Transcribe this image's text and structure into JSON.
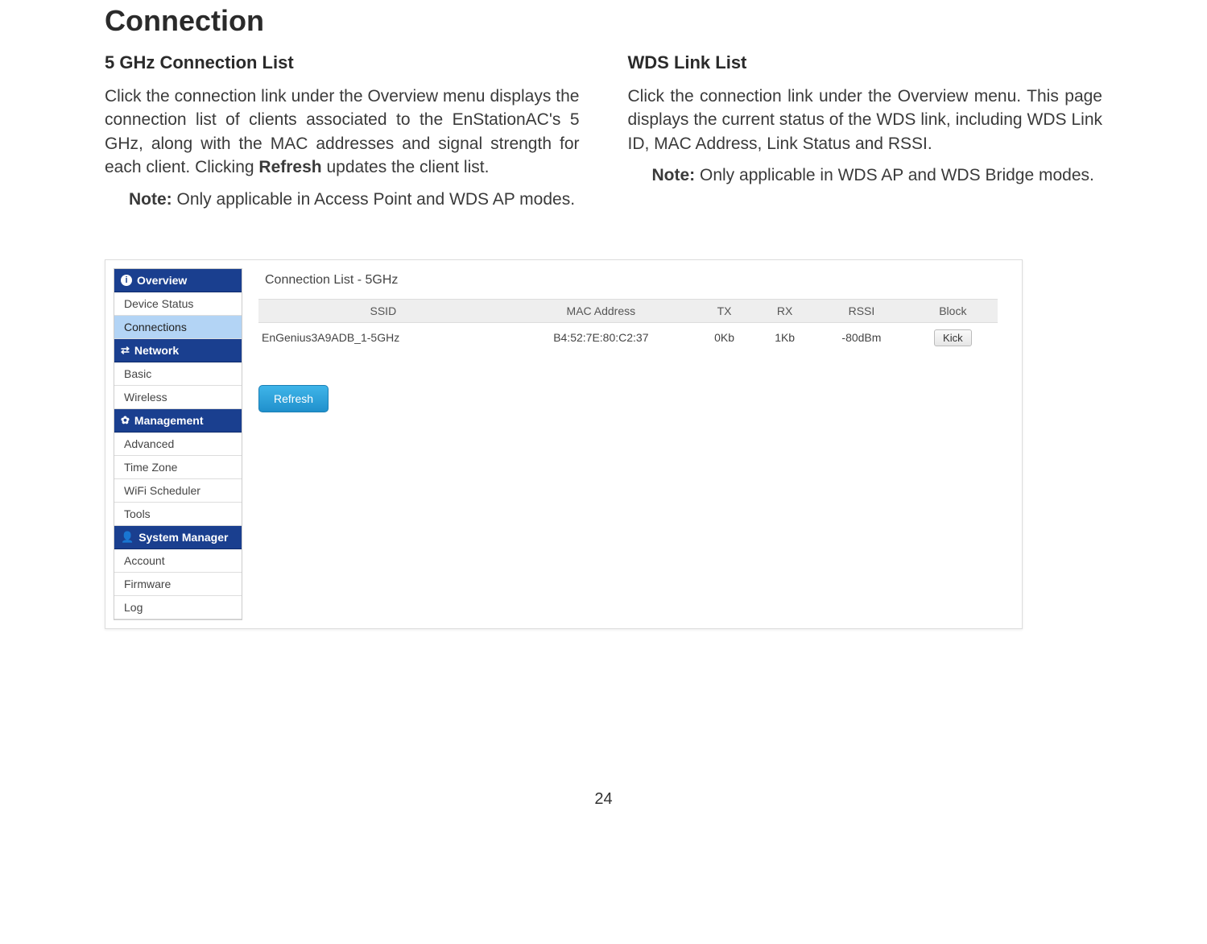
{
  "page": {
    "title": "Connection",
    "number": "24"
  },
  "left_column": {
    "heading": "5 GHz Connection List",
    "body_pre": "Click the connection link under the Overview menu displays the connection list of clients associated to the EnStationAC's 5 GHz, along with the MAC addresses and signal strength for each client. Clicking ",
    "body_bold": "Refresh",
    "body_post": " updates the client list.",
    "note_label": "Note:",
    "note_text": " Only applicable in Access Point and WDS AP modes."
  },
  "right_column": {
    "heading": "WDS Link List",
    "body": "Click the connection link under the Overview menu. This page displays the current status of the WDS link, including WDS Link ID, MAC Address, Link Status and RSSI.",
    "note_label": "Note:",
    "note_text": " Only applicable in WDS AP and WDS Bridge modes."
  },
  "admin_ui": {
    "sidebar": {
      "sections": [
        {
          "header": "Overview",
          "icon": "info-icon",
          "items": [
            "Device Status",
            "Connections"
          ],
          "active_index": 1
        },
        {
          "header": "Network",
          "icon": "network-icon",
          "items": [
            "Basic",
            "Wireless"
          ],
          "active_index": -1
        },
        {
          "header": "Management",
          "icon": "gear-icon",
          "items": [
            "Advanced",
            "Time Zone",
            "WiFi Scheduler",
            "Tools"
          ],
          "active_index": -1
        },
        {
          "header": "System Manager",
          "icon": "user-icon",
          "items": [
            "Account",
            "Firmware",
            "Log"
          ],
          "active_index": -1
        }
      ]
    },
    "panel_title": "Connection List - 5GHz",
    "table": {
      "headers": [
        "SSID",
        "MAC Address",
        "TX",
        "RX",
        "RSSI",
        "Block"
      ],
      "rows": [
        {
          "ssid": "EnGenius3A9ADB_1-5GHz",
          "mac": "B4:52:7E:80:C2:37",
          "tx": "0Kb",
          "rx": "1Kb",
          "rssi": "-80dBm",
          "block": "Kick"
        }
      ]
    },
    "refresh_label": "Refresh"
  }
}
